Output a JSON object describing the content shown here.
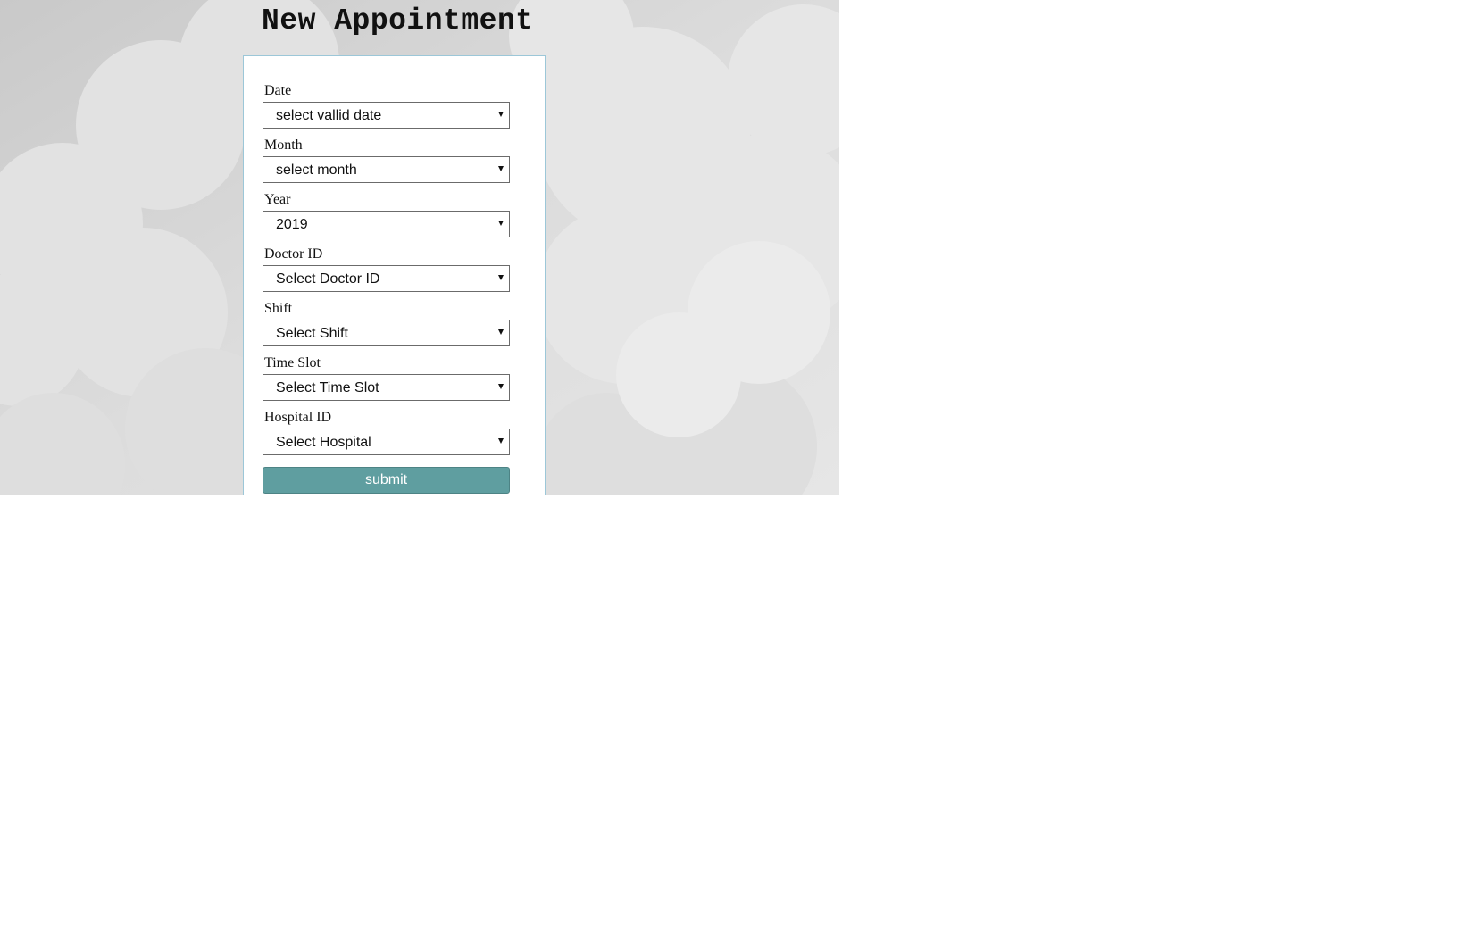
{
  "page": {
    "title": "New Appointment"
  },
  "form": {
    "fields": [
      {
        "label": "Date",
        "value": "select vallid date"
      },
      {
        "label": "Month",
        "value": "select month"
      },
      {
        "label": "Year",
        "value": "2019"
      },
      {
        "label": "Doctor ID",
        "value": "Select Doctor ID"
      },
      {
        "label": "Shift",
        "value": "Select Shift"
      },
      {
        "label": "Time Slot",
        "value": "Select Time Slot"
      },
      {
        "label": "Hospital ID",
        "value": "Select Hospital"
      }
    ],
    "submit_label": "submit"
  },
  "colors": {
    "submit_button": "#5f9ea0",
    "card_border": "#9cc7d8",
    "background": "#d9d9d9"
  }
}
